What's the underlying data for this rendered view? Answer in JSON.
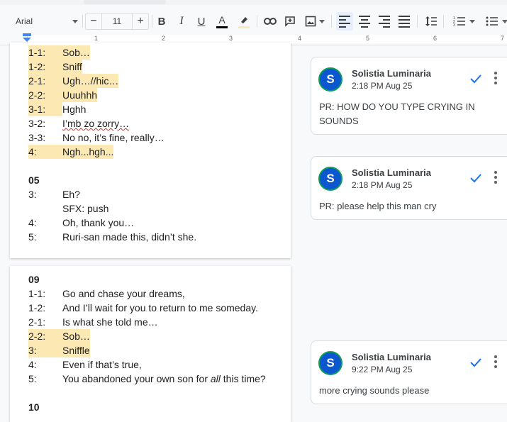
{
  "toolbar": {
    "font": "Arial",
    "font_size": "11",
    "minus": "−",
    "plus": "+",
    "bold": "B",
    "italic": "I",
    "underline": "U",
    "text_color": "A",
    "text_color_swatch": "#000000",
    "highlight_swatch": "#fce8b2"
  },
  "ruler": {
    "numbers": [
      "1",
      "2",
      "3",
      "4",
      "5",
      "6",
      "7"
    ]
  },
  "document": {
    "page1": [
      {
        "num": "1-1:",
        "text": "Sob…",
        "highlight": true
      },
      {
        "num": "1-2:",
        "text": "Sniff",
        "highlight": true
      },
      {
        "num": "2-1:",
        "text": "Ugh…//hic…",
        "highlight": true
      },
      {
        "num": "2-2:",
        "text": "Uuuhhh",
        "highlight": true
      },
      {
        "num": "3-1:",
        "text": "Hghh",
        "highlight": true
      },
      {
        "num": "3-2:",
        "text": "I’mb zo zorry…",
        "highlight": false
      },
      {
        "num": "3-3:",
        "text": "No no, it’s fine, really…",
        "highlight": false
      },
      {
        "num": "4:",
        "text": "Ngh...hgh...",
        "highlight": true
      },
      {
        "num": "05",
        "text": "",
        "highlight": false
      },
      {
        "num": "3:",
        "text": "Eh?",
        "highlight": false
      },
      {
        "num": "",
        "text": "SFX: push",
        "highlight": false
      },
      {
        "num": "4:",
        "text": "Oh, thank you…",
        "highlight": false
      },
      {
        "num": "5:",
        "text": "Ruri-san made this, didn’t she.",
        "highlight": false
      }
    ],
    "page2": [
      {
        "num": "09",
        "text": "",
        "highlight": false
      },
      {
        "num": "1-1:",
        "text": "Go and chase your dreams,",
        "highlight": false
      },
      {
        "num": "1-2:",
        "text": "And I’ll wait for you to return to me someday.",
        "highlight": false
      },
      {
        "num": "2-1:",
        "text": "Is what she told me…",
        "highlight": false
      },
      {
        "num": "2-2:",
        "text": "Sob…",
        "highlight": true
      },
      {
        "num": "3:",
        "text": "Sniffle",
        "highlight": true
      },
      {
        "num": "4:",
        "text": "Even if that’s true,",
        "highlight": false
      },
      {
        "num": "5:",
        "text": "You abandoned your own son for all this time?",
        "highlight": false
      },
      {
        "num": "10",
        "text": "",
        "highlight": false
      }
    ]
  },
  "comments": [
    {
      "avatar": "S",
      "author": "Solistia Luminaria",
      "time": "2:18 PM Aug 25",
      "text": "PR: HOW DO YOU TYPE CRYING IN SOUNDS"
    },
    {
      "avatar": "S",
      "author": "Solistia Luminaria",
      "time": "2:18 PM Aug 25",
      "text": "PR: please help this man cry"
    },
    {
      "avatar": "S",
      "author": "Solistia Luminaria",
      "time": "9:22 PM Aug 25",
      "text": "more crying sounds please"
    }
  ]
}
